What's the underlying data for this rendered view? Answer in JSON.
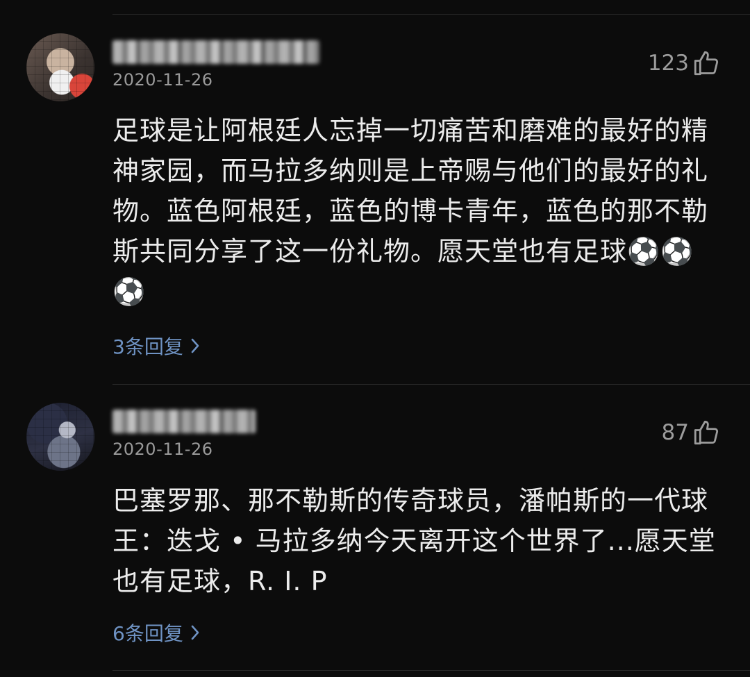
{
  "comments": [
    {
      "date": "2020-11-26",
      "likes": "123",
      "text": "足球是让阿根廷人忘掉一切痛苦和磨难的最好的精神家园，而马拉多纳则是上帝赐与他们的最好的礼物。蓝色阿根廷，蓝色的博卡青年，蓝色的那不勒斯共同分享了这一份礼物。愿天堂也有足球⚽⚽⚽",
      "replies": "3条回复"
    },
    {
      "date": "2020-11-26",
      "likes": "87",
      "text": "巴塞罗那、那不勒斯的传奇球员，潘帕斯的一代球王：迭戈 • 马拉多纳今天离开这个世界了...愿天堂也有足球，R. I. P",
      "replies": "6条回复"
    }
  ],
  "colors": {
    "background": "#0c0c0c",
    "text": "#ececec",
    "secondary": "#9a9a9a",
    "link": "#6f93c4"
  },
  "icons": {
    "like": "thumbs-up-icon",
    "replies_arrow": "chevron-right-icon"
  }
}
